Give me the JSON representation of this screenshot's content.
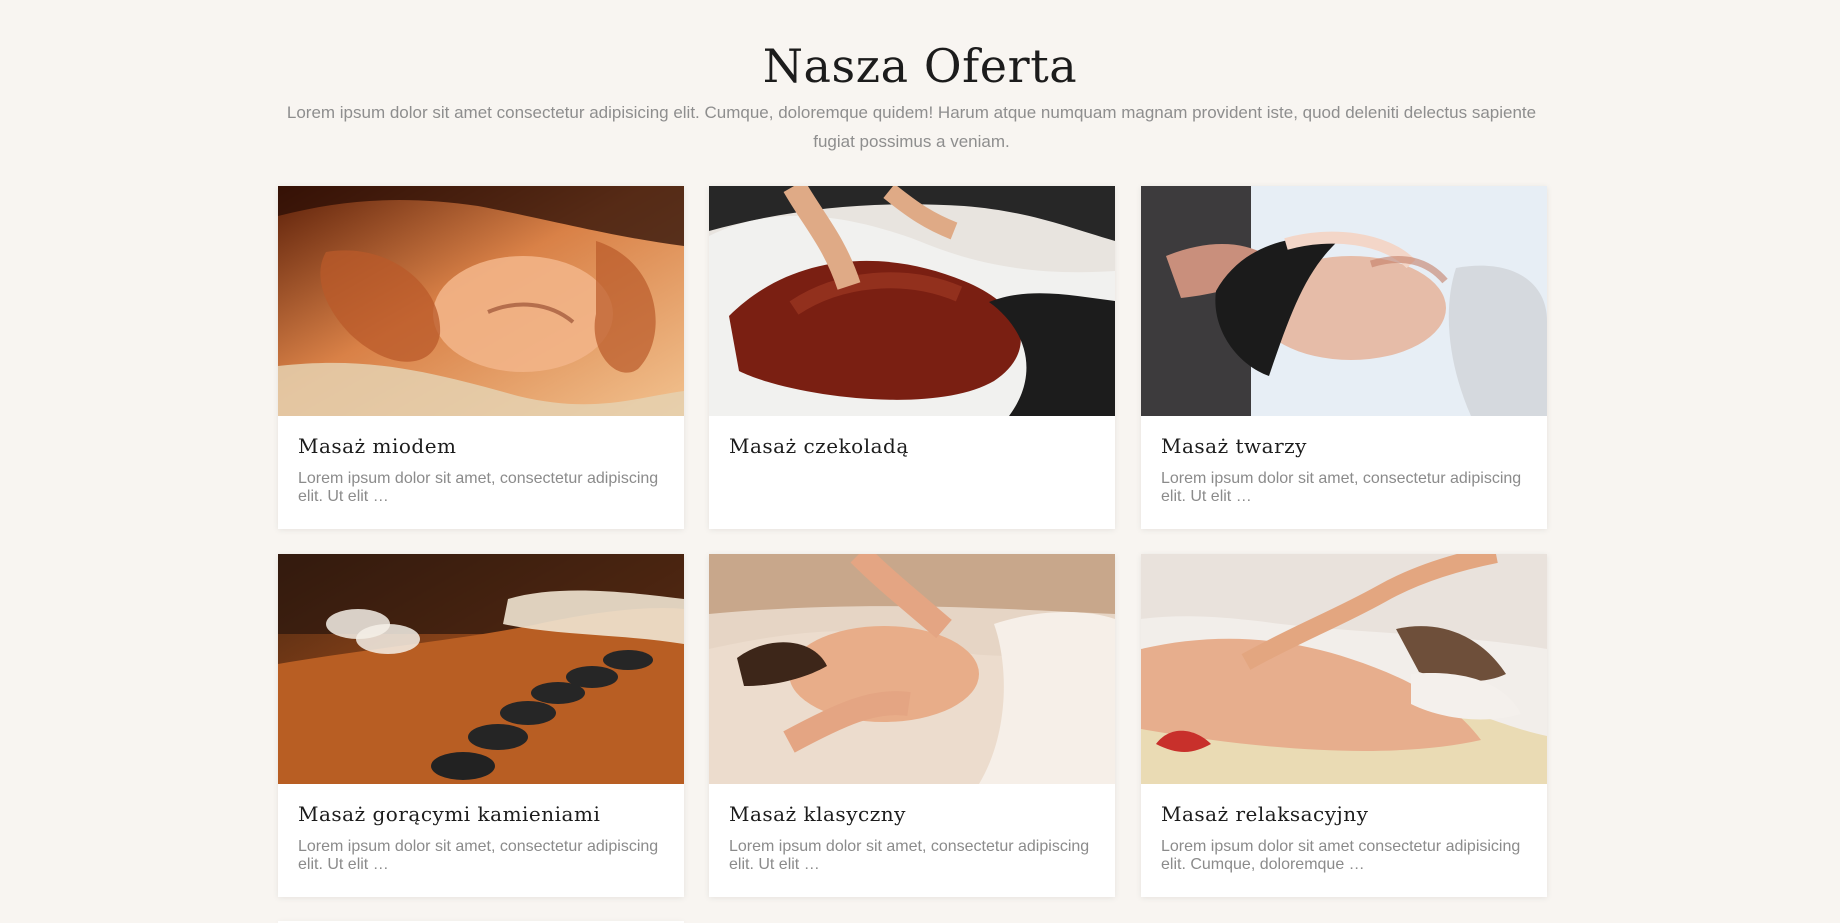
{
  "section": {
    "title": "Nasza Oferta",
    "subtitle": "Lorem ipsum dolor sit amet consectetur adipisicing elit. Cumque, doloremque quidem! Harum atque numquam magnam provident iste, quod deleniti delectus sapiente fugiat possimus a veniam."
  },
  "cards": [
    {
      "title": "Masaż miodem",
      "description": "Lorem ipsum dolor sit amet, consectetur adipiscing elit. Ut elit …",
      "image": "honey-massage-image"
    },
    {
      "title": "Masaż czekoladą",
      "description": "",
      "image": "chocolate-massage-image"
    },
    {
      "title": "Masaż twarzy",
      "description": "Lorem ipsum dolor sit amet, consectetur adipiscing elit. Ut elit …",
      "image": "face-massage-image"
    },
    {
      "title": "Masaż gorącymi kamieniami",
      "description": "Lorem ipsum dolor sit amet, consectetur adipiscing elit. Ut elit …",
      "image": "hot-stone-massage-image"
    },
    {
      "title": "Masaż klasyczny",
      "description": "Lorem ipsum dolor sit amet, consectetur adipiscing elit. Ut elit …",
      "image": "classic-massage-image"
    },
    {
      "title": "Masaż relaksacyjny",
      "description": "Lorem ipsum dolor sit amet consectetur adipisicing elit. Cumque, doloremque …",
      "image": "relaxing-massage-image"
    }
  ],
  "colors": {
    "background": "#f8f5f1",
    "card": "#ffffff",
    "heading": "#1c1c1c",
    "text": "#8b8b8b"
  }
}
